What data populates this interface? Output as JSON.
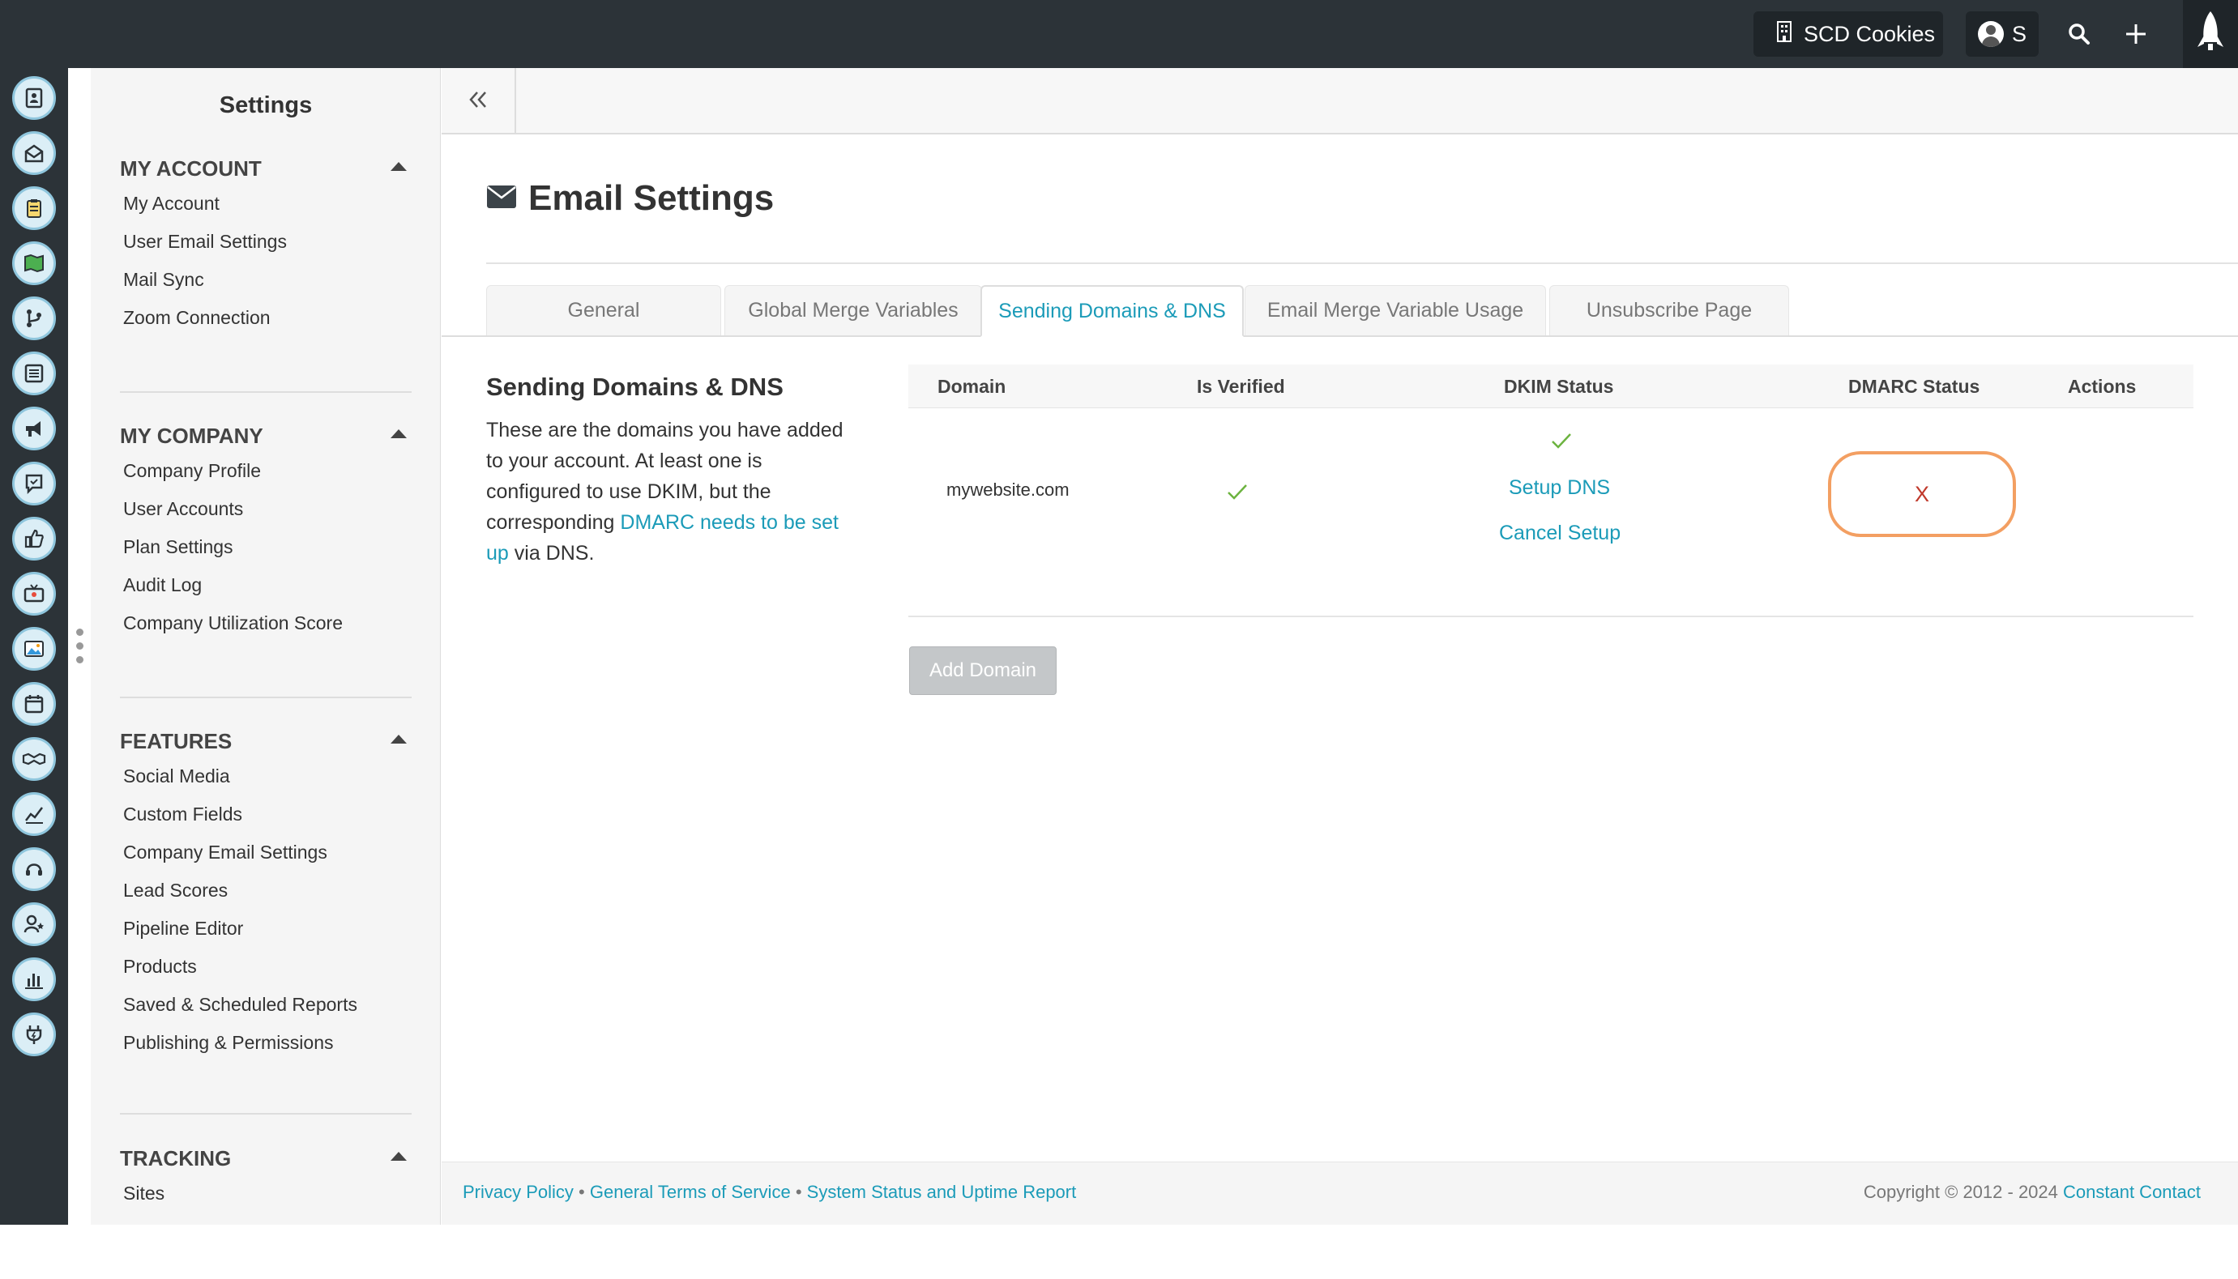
{
  "topbar": {
    "account_label": "SCD Cookies",
    "user_initial": "S",
    "icons": [
      "building-icon",
      "avatar",
      "search-icon",
      "plus-icon",
      "rocket-icon"
    ]
  },
  "rail": {
    "icons": [
      "contacts-icon",
      "email-icon",
      "clipboard-icon",
      "map-icon",
      "branch-icon",
      "list-icon",
      "megaphone-icon",
      "chat-icon",
      "thumbs-up-icon",
      "tv-icon",
      "image-icon",
      "calendar-icon",
      "handshake-icon",
      "trend-chart-icon",
      "headset-icon",
      "user-star-icon",
      "bar-chart-icon",
      "plug-icon",
      "gear-icon"
    ]
  },
  "sidebar": {
    "title": "Settings",
    "sections": [
      {
        "heading": "MY ACCOUNT",
        "items": [
          "My Account",
          "User Email Settings",
          "Mail Sync",
          "Zoom Connection"
        ]
      },
      {
        "heading": "MY COMPANY",
        "items": [
          "Company Profile",
          "User Accounts",
          "Plan Settings",
          "Audit Log",
          "Company Utilization Score"
        ]
      },
      {
        "heading": "FEATURES",
        "items": [
          "Social Media",
          "Custom Fields",
          "Company Email Settings",
          "Lead Scores",
          "Pipeline Editor",
          "Products",
          "Saved & Scheduled Reports",
          "Publishing & Permissions"
        ]
      },
      {
        "heading": "TRACKING",
        "items": [
          "Sites"
        ]
      }
    ]
  },
  "page": {
    "title": "Email Settings",
    "tabs": [
      "General",
      "Global Merge Variables",
      "Sending Domains & DNS",
      "Email Merge Variable Usage",
      "Unsubscribe Page"
    ],
    "active_tab": "Sending Domains & DNS"
  },
  "section": {
    "title": "Sending Domains & DNS",
    "desc_before": "These are the domains you have added to your account. At least one is configured to use DKIM, but the corresponding ",
    "desc_link": "DMARC needs to be set up",
    "desc_after": " via DNS."
  },
  "table": {
    "headers": {
      "domain": "Domain",
      "verified": "Is Verified",
      "dkim": "DKIM Status",
      "dmarc": "DMARC Status",
      "actions": "Actions"
    },
    "rows": [
      {
        "domain": "mywebsite.com",
        "dkim_setup": "Setup DNS",
        "dkim_cancel": "Cancel Setup",
        "dmarc": "X"
      }
    ]
  },
  "add_domain_label": "Add Domain",
  "footer": {
    "link1": "Privacy Policy",
    "link2": "General Terms of Service",
    "link3": "System Status and Uptime Report",
    "sep": "•",
    "copyright": "Copyright © 2012 - 2024",
    "brand": "Constant Contact"
  },
  "colors": {
    "accent": "#1b9bb8",
    "highlight": "#f39f62",
    "error": "#c0392b",
    "check": "#6cb33f"
  }
}
